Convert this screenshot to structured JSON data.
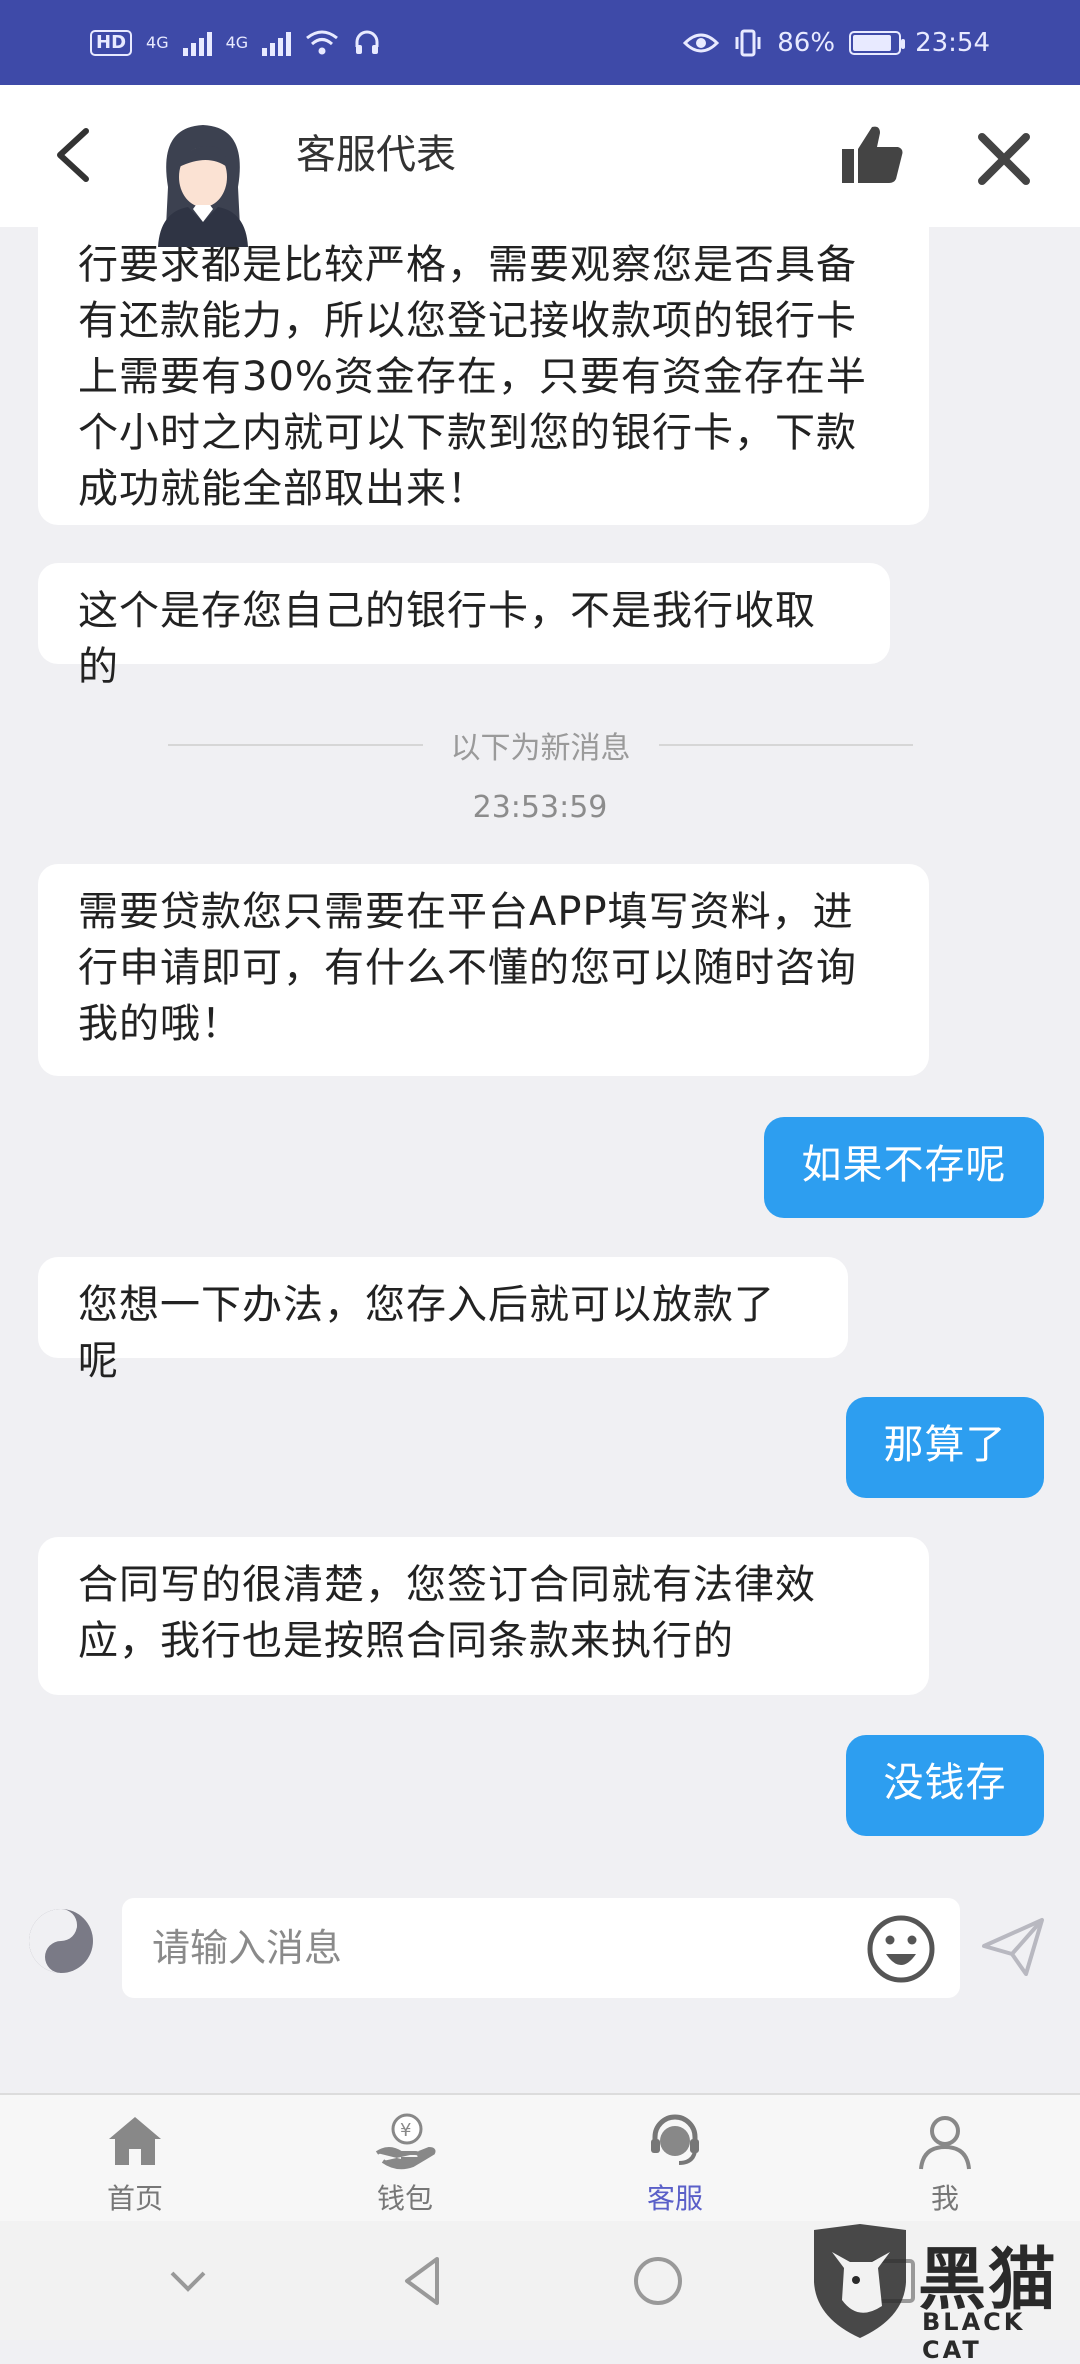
{
  "status_bar": {
    "hd_label": "HD",
    "signal1_label": "4G",
    "signal2_label": "4G",
    "battery_percent": "86%",
    "battery_level": 0.86,
    "time": "23:54"
  },
  "header": {
    "title": "客服代表"
  },
  "messages": [
    {
      "from": "agent",
      "text": "行要求都是比较严格，需要观察您是否具备有还款能力，所以您登记接收款项的银行卡上需要有30%资金存在，只要有资金存在半个小时之内就可以下款到您的银行卡，下款成功就能全部取出来！"
    },
    {
      "from": "agent",
      "text": "这个是存您自己的银行卡，不是我行收取的"
    },
    {
      "from": "agent",
      "text": "需要贷款您只需要在平台APP填写资料，进行申请即可，有什么不懂的您可以随时咨询我的哦！"
    },
    {
      "from": "user",
      "text": "如果不存呢"
    },
    {
      "from": "agent",
      "text": "您想一下办法，您存入后就可以放款了呢"
    },
    {
      "from": "user",
      "text": "那算了"
    },
    {
      "from": "agent",
      "text": "合同写的很清楚，您签订合同就有法律效应，我行也是按照合同条款来执行的"
    },
    {
      "from": "user",
      "text": "没钱存"
    }
  ],
  "divider": {
    "label": "以下为新消息",
    "time": "23:53:59"
  },
  "input": {
    "placeholder": "请输入消息"
  },
  "tabs": [
    {
      "label": "首页",
      "icon": "home-icon",
      "active": false
    },
    {
      "label": "钱包",
      "icon": "wallet-icon",
      "active": false
    },
    {
      "label": "客服",
      "icon": "customer-service-icon",
      "active": true
    },
    {
      "label": "我",
      "icon": "profile-icon",
      "active": false
    }
  ],
  "watermark": {
    "cn": "黑猫",
    "en": "BLACK CAT"
  },
  "colors": {
    "status_bar": "#3e4aa8",
    "user_bubble": "#2d9ef0",
    "active_tab": "#5a5fc8"
  }
}
